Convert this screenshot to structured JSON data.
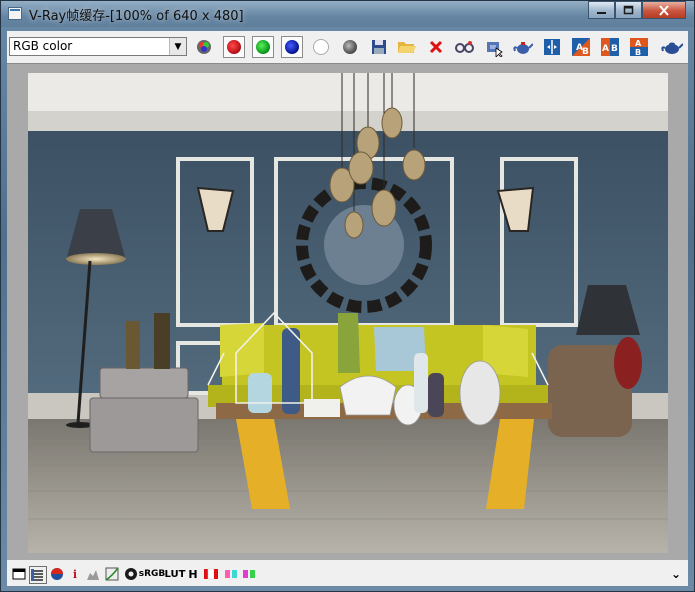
{
  "window": {
    "title": "V-Ray帧缓存-[100% of 640 x 480]",
    "minimize_glyph": "—",
    "maximize_glyph": "☐",
    "close_glyph": "✕"
  },
  "toolbar": {
    "channel_value": "RGB color",
    "dropdown_glyph": "▼",
    "icons": [
      "rgb-channels-icon",
      "red-channel-icon",
      "green-channel-icon",
      "blue-channel-icon",
      "alpha-channel-icon",
      "monochrome-icon",
      "save-image-icon",
      "open-image-icon",
      "clear-image-icon",
      "track-mouse-icon",
      "region-render-icon",
      "render-teapot-icon",
      "compare-ab-icon",
      "history-a-icon",
      "history-ab-icon",
      "history-b-icon",
      "render-last-teapot-icon"
    ],
    "history_labels": {
      "a": "A",
      "b": "B"
    }
  },
  "statusbar": {
    "info_glyph": "i",
    "srgb_label": "sRGB",
    "lut_label": "LUT",
    "h_label": "H",
    "expand_glyph": "⌄"
  },
  "colors": {
    "red_channel": "#c0141b",
    "green_channel": "#10a020",
    "blue_channel": "#0b1c9e",
    "wall": "#4a6176",
    "sofa": "#c4c423",
    "table_legs": "#e5b028"
  }
}
